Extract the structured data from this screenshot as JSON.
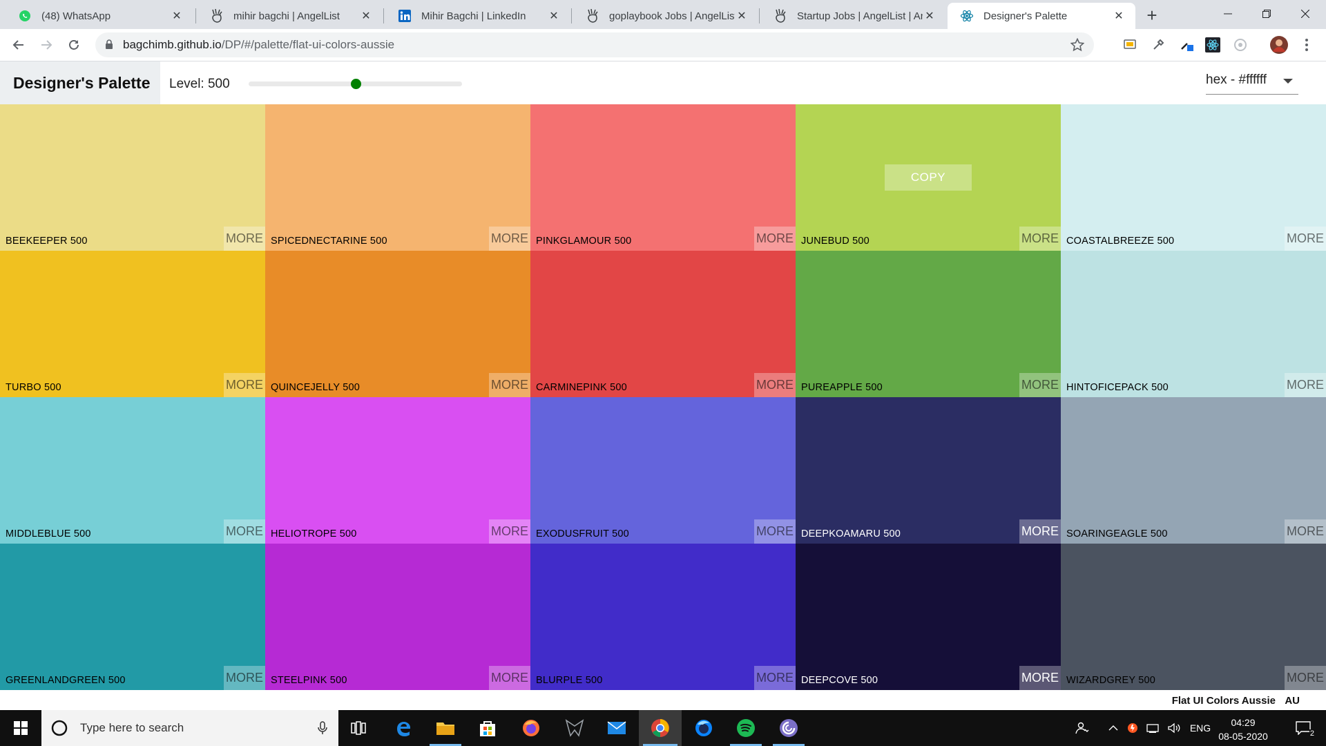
{
  "browser": {
    "tabs": [
      {
        "title": "(48) WhatsApp",
        "icon": "whatsapp-icon",
        "active": false
      },
      {
        "title": "mihir bagchi | AngelList",
        "icon": "angellist-icon",
        "active": false
      },
      {
        "title": "Mihir Bagchi | LinkedIn",
        "icon": "linkedin-icon",
        "active": false
      },
      {
        "title": "goplaybook Jobs | AngelList",
        "icon": "angellist-icon",
        "active": false
      },
      {
        "title": "Startup Jobs | AngelList | Ang",
        "icon": "angellist-icon",
        "active": false
      },
      {
        "title": "Designer's Palette",
        "icon": "react-icon",
        "active": true
      }
    ],
    "url_host": "bagchimb.github.io",
    "url_path": "/DP/#/palette/flat-ui-colors-aussie"
  },
  "app": {
    "brand": "Designer's Palette",
    "level_label": "Level: 500",
    "level_value": 500,
    "level_fraction": 0.5,
    "format_select": "hex - #ffffff",
    "accent_color": "#008000"
  },
  "palette": {
    "copy_label": "COPY",
    "more_label": "MORE",
    "colors": [
      {
        "name": "BEEKEEPER 500",
        "color": "#ebdc87",
        "tone": "light"
      },
      {
        "name": "SPICEDNECTARINE 500",
        "color": "#f5b46f",
        "tone": "light"
      },
      {
        "name": "PINKGLAMOUR 500",
        "color": "#f47171",
        "tone": "light"
      },
      {
        "name": "JUNEBUD 500",
        "color": "#b4d453",
        "tone": "light",
        "copy": true
      },
      {
        "name": "COASTALBREEZE 500",
        "color": "#d4eef0",
        "tone": "light"
      },
      {
        "name": "TURBO 500",
        "color": "#f0c120",
        "tone": "light"
      },
      {
        "name": "QUINCEJELLY 500",
        "color": "#e88c28",
        "tone": "light"
      },
      {
        "name": "CARMINEPINK 500",
        "color": "#e24646",
        "tone": "light"
      },
      {
        "name": "PUREAPPLE 500",
        "color": "#63a947",
        "tone": "light"
      },
      {
        "name": "HINTOFICEPACK 500",
        "color": "#bde2e3",
        "tone": "light"
      },
      {
        "name": "MIDDLEBLUE 500",
        "color": "#77cfd6",
        "tone": "light"
      },
      {
        "name": "HELIOTROPE 500",
        "color": "#d94ff2",
        "tone": "light"
      },
      {
        "name": "EXODUSFRUIT 500",
        "color": "#6464dc",
        "tone": "light"
      },
      {
        "name": "DEEPKOAMARU 500",
        "color": "#2b2d63",
        "tone": "dark"
      },
      {
        "name": "SOARINGEAGLE 500",
        "color": "#94a5b4",
        "tone": "light"
      },
      {
        "name": "GREENLANDGREEN 500",
        "color": "#229aa6",
        "tone": "light"
      },
      {
        "name": "STEELPINK 500",
        "color": "#b62ad4",
        "tone": "light"
      },
      {
        "name": "BLURPLE 500",
        "color": "#412cc9",
        "tone": "light"
      },
      {
        "name": "DEEPCOVE 500",
        "color": "#150f38",
        "tone": "dark"
      },
      {
        "name": "WIZARDGREY 500",
        "color": "#4b5360",
        "tone": "light"
      }
    ]
  },
  "footer": {
    "palette_name": "Flat UI Colors Aussie",
    "emoji": "AU"
  },
  "taskbar": {
    "search_placeholder": "Type here to search",
    "language": "ENG",
    "time": "04:29",
    "date": "08-05-2020",
    "notification_count": "2"
  }
}
